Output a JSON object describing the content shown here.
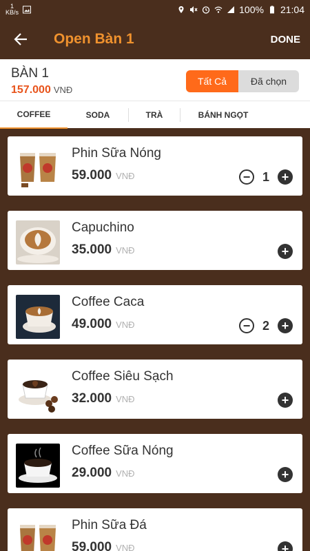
{
  "status_bar": {
    "speed_value": "1",
    "speed_unit": "KB/s",
    "battery": "100%",
    "time": "21:04"
  },
  "app_bar": {
    "title": "Open Bàn 1",
    "done_label": "DONE"
  },
  "table": {
    "name": "BÀN 1",
    "total": "157.000",
    "currency": "VNĐ"
  },
  "filters": {
    "all_label": "Tất Cả",
    "selected_label": "Đã chọn"
  },
  "tabs": [
    {
      "label": "COFFEE"
    },
    {
      "label": "SODA"
    },
    {
      "label": "TRÀ"
    },
    {
      "label": "BÁNH NGỌT"
    }
  ],
  "products": [
    {
      "name": "Phin Sữa Nóng",
      "price": "59.000",
      "currency": "VNĐ",
      "qty": "1"
    },
    {
      "name": "Capuchino",
      "price": "35.000",
      "currency": "VNĐ",
      "qty": ""
    },
    {
      "name": "Coffee Caca",
      "price": "49.000",
      "currency": "VNĐ",
      "qty": "2"
    },
    {
      "name": "Coffee Siêu Sạch",
      "price": "32.000",
      "currency": "VNĐ",
      "qty": ""
    },
    {
      "name": "Coffee Sữa Nóng",
      "price": "29.000",
      "currency": "VNĐ",
      "qty": ""
    },
    {
      "name": "Phin Sữa Đá",
      "price": "59.000",
      "currency": "VNĐ",
      "qty": ""
    }
  ],
  "colors": {
    "brand_brown": "#4a2e1d",
    "accent_orange": "#f0922e",
    "total_red": "#e8541c",
    "filter_active": "#ff6a1a"
  },
  "icons": {
    "back": "arrow-left-icon",
    "minus": "minus-circle-icon",
    "plus": "plus-circle-icon"
  }
}
